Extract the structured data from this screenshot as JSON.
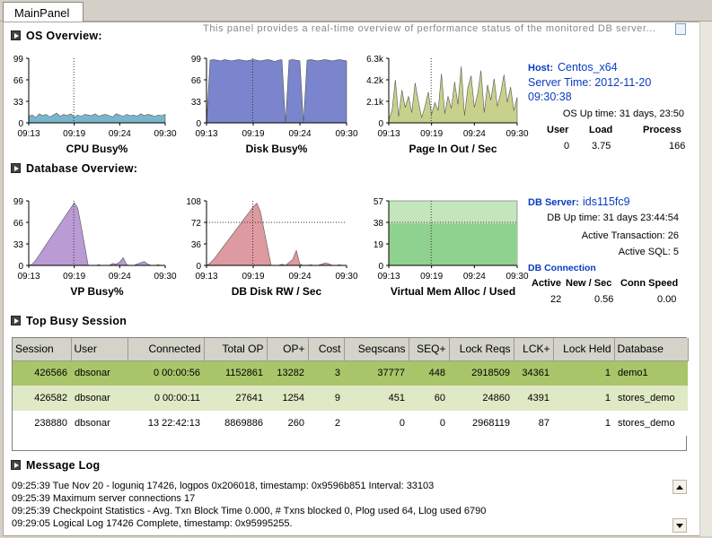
{
  "tab": {
    "label": "MainPanel"
  },
  "description": "This panel provides a real-time overview of performance status of the monitored DB server...",
  "os_overview": {
    "title": "OS Overview:",
    "host_label": "Host:",
    "host_value": "Centos_x64",
    "server_time": "Server Time: 2012-11-20",
    "server_time2": "09:30:38",
    "uptime": "OS Up time: 31 days, 23:50",
    "cols": [
      "User",
      "Load",
      "Process"
    ],
    "vals": [
      "0",
      "3.75",
      "166"
    ]
  },
  "db_overview": {
    "title": "Database Overview:",
    "server_label": "DB Server:",
    "server_value": "ids115fc9",
    "uptime": "DB Up time: 31 days 23:44:54",
    "active_txn": "Active Transaction: 26",
    "active_sql": "Active SQL: 5",
    "conn_label": "DB Connection",
    "cols": [
      "Active",
      "New / Sec",
      "Conn Speed"
    ],
    "vals": [
      "22",
      "0.56",
      "0.00"
    ]
  },
  "chart_data": [
    {
      "id": "cpu",
      "type": "area",
      "title": "CPU Busy%",
      "x_ticks": [
        "09:13",
        "09:19",
        "09:24",
        "09:30"
      ],
      "y_ticks": [
        "99",
        "66",
        "33",
        "0"
      ],
      "ylim": [
        0,
        99
      ],
      "color": "#6aaec7",
      "values": [
        10,
        12,
        8,
        14,
        11,
        13,
        9,
        12,
        15,
        10,
        13,
        11,
        14,
        9,
        12,
        10,
        13,
        12,
        11,
        14,
        10,
        12,
        13,
        11,
        9,
        14,
        12,
        10,
        13,
        11,
        12,
        10,
        14,
        11,
        13,
        12,
        10,
        12,
        11,
        13
      ]
    },
    {
      "id": "disk",
      "type": "area",
      "title": "Disk Busy%",
      "x_ticks": [
        "09:13",
        "09:19",
        "09:24",
        "09:30"
      ],
      "y_ticks": [
        "99",
        "66",
        "33",
        "0"
      ],
      "ylim": [
        0,
        99
      ],
      "color": "#6c78c8",
      "values": [
        0,
        96,
        97,
        96,
        95,
        97,
        96,
        95,
        96,
        97,
        96,
        95,
        96,
        97,
        96,
        95,
        96,
        97,
        96,
        94,
        96,
        97,
        0,
        96,
        97,
        96,
        95,
        0,
        96,
        97,
        96,
        95,
        96,
        97,
        96,
        95,
        96,
        97,
        96,
        95
      ]
    },
    {
      "id": "page",
      "type": "area",
      "title": "Page In Out / Sec",
      "x_ticks": [
        "09:13",
        "09:19",
        "09:24",
        "09:30"
      ],
      "y_ticks": [
        "6.3k",
        "4.2k",
        "2.1k",
        "0"
      ],
      "ylim": [
        0,
        6300
      ],
      "color": "#c2cc7e",
      "values": [
        300,
        1200,
        4200,
        600,
        3200,
        1500,
        2600,
        1000,
        3900,
        2100,
        500,
        1600,
        3000,
        800,
        2000,
        1200,
        4800,
        900,
        2600,
        1400,
        4000,
        1800,
        5500,
        700,
        3400,
        4600,
        1500,
        2800,
        5100,
        1000,
        3700,
        2200,
        4300,
        1600,
        2900,
        4700,
        2000,
        3500,
        1200,
        2500
      ]
    },
    {
      "id": "vp",
      "type": "area",
      "title": "VP Busy%",
      "x_ticks": [
        "09:13",
        "09:19",
        "09:24",
        "09:30"
      ],
      "y_ticks": [
        "99",
        "66",
        "33",
        "0"
      ],
      "ylim": [
        0,
        99
      ],
      "color": "#b390cf",
      "values": [
        0,
        2,
        8,
        16,
        24,
        32,
        40,
        48,
        56,
        64,
        72,
        80,
        88,
        96,
        88,
        60,
        30,
        0,
        0,
        0,
        1,
        0,
        0,
        0,
        3,
        2,
        5,
        12,
        1,
        0,
        0,
        2,
        4,
        6,
        2,
        0,
        0,
        1,
        0,
        0
      ]
    },
    {
      "id": "dbdisk",
      "type": "area",
      "title": "DB Disk RW / Sec",
      "x_ticks": [
        "09:13",
        "09:19",
        "09:24",
        "09:30"
      ],
      "y_ticks": [
        "108",
        "72",
        "36",
        "0"
      ],
      "ylim": [
        0,
        108
      ],
      "color": "#d98f96",
      "values": [
        0,
        4,
        10,
        18,
        26,
        34,
        42,
        50,
        58,
        66,
        74,
        82,
        90,
        98,
        104,
        90,
        60,
        30,
        0,
        0,
        0,
        2,
        0,
        5,
        10,
        25,
        2,
        0,
        0,
        1,
        0,
        0,
        2,
        4,
        3,
        0,
        0,
        1,
        0,
        0
      ]
    },
    {
      "id": "vmem",
      "type": "area",
      "title": "Virtual Mem Alloc / Used",
      "x_ticks": [
        "09:13",
        "09:19",
        "09:24",
        "09:30"
      ],
      "y_ticks": [
        "57",
        "38",
        "19",
        "0"
      ],
      "ylim": [
        0,
        57
      ],
      "color": "#8fd18f",
      "alloc": 57,
      "used": 37
    }
  ],
  "sessions": {
    "title": "Top Busy Session",
    "headers": [
      "Session",
      "User",
      "Connected",
      "Total OP",
      "OP+",
      "Cost",
      "Seqscans",
      "SEQ+",
      "Lock Reqs",
      "LCK+",
      "Lock Held",
      "Database"
    ],
    "rows": [
      [
        "426566",
        "dbsonar",
        "0 00:00:56",
        "1152861",
        "13282",
        "3",
        "37777",
        "448",
        "2918509",
        "34361",
        "1",
        "demo1"
      ],
      [
        "426582",
        "dbsonar",
        "0 00:00:11",
        "27641",
        "1254",
        "9",
        "451",
        "60",
        "24860",
        "4391",
        "1",
        "stores_demo"
      ],
      [
        "238880",
        "dbsonar",
        "13 22:42:13",
        "8869886",
        "260",
        "2",
        "0",
        "0",
        "2968119",
        "87",
        "1",
        "stores_demo"
      ]
    ]
  },
  "message_log": {
    "title": "Message Log",
    "lines": [
      "09:25:39 Tue Nov 20 - loguniq 17426, logpos 0x206018, timestamp: 0x9596b851 Interval: 33103",
      "09:25:39 Maximum server connections 17",
      "09:25:39 Checkpoint Statistics - Avg. Txn Block Time 0.000, # Txns blocked 0, Plog used 64, Llog used 6790",
      "09:29:05 Logical Log 17426 Complete, timestamp: 0x95995255."
    ]
  }
}
